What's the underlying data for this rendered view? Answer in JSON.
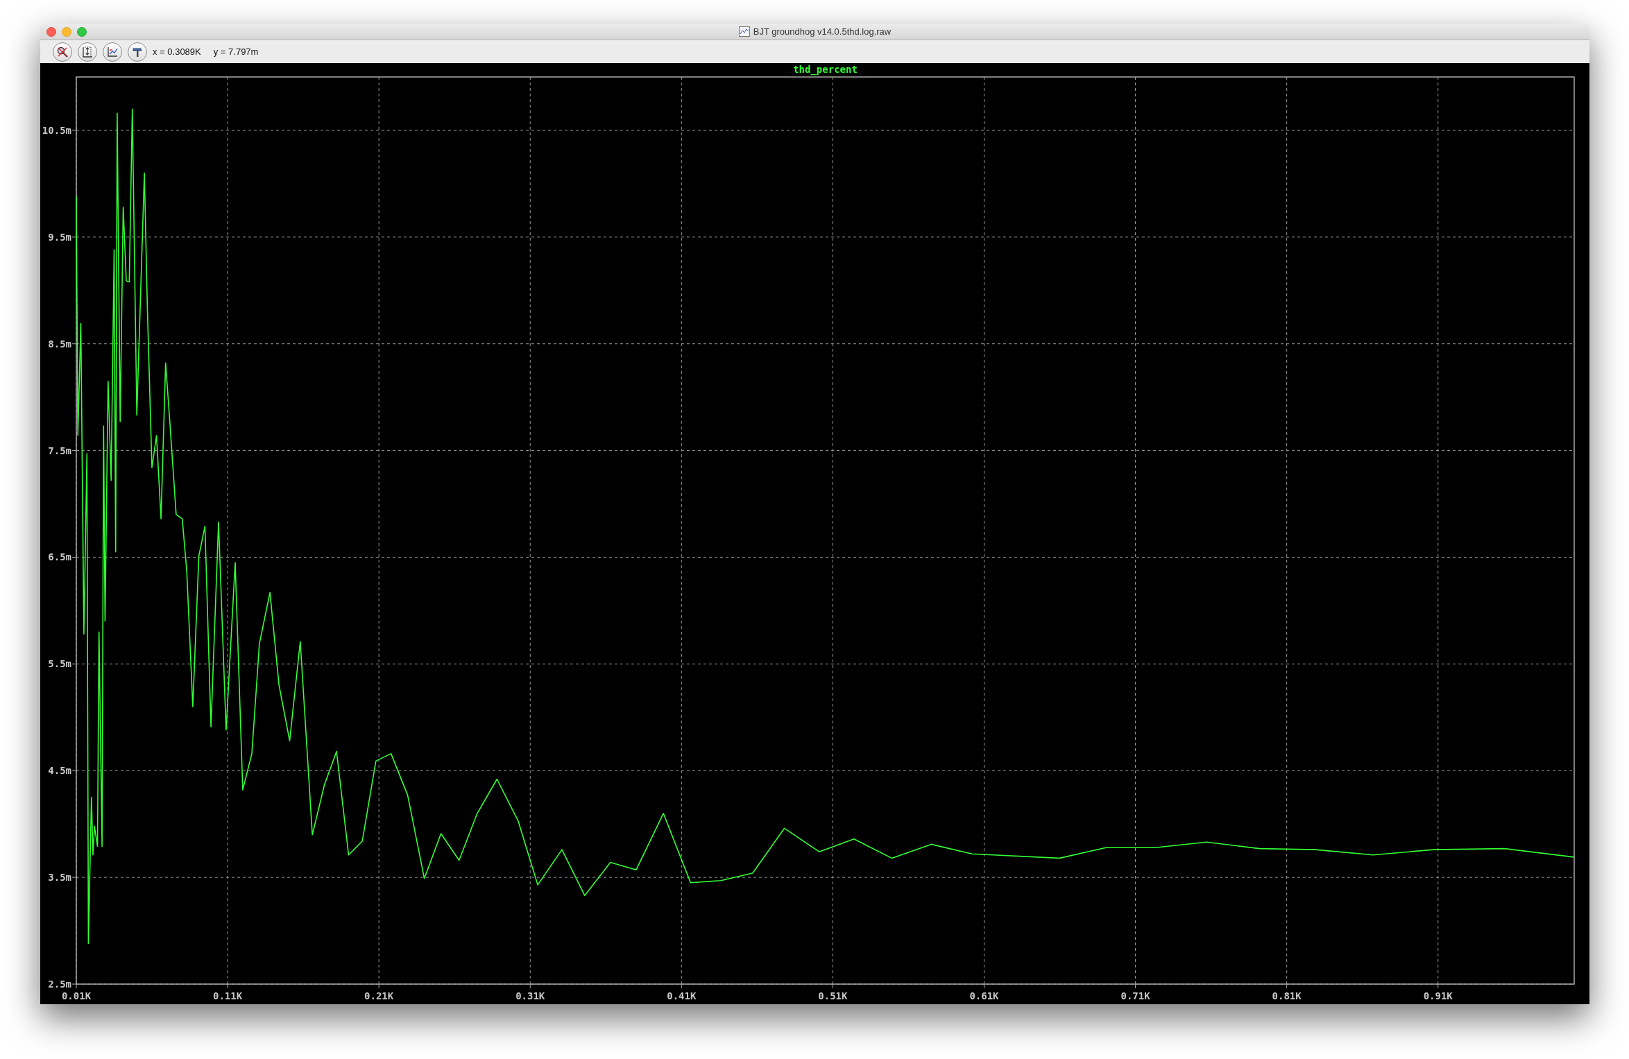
{
  "window": {
    "title": "BJT groundhog v14.0.5thd.log.raw"
  },
  "toolbar": {
    "cursor_x": "x = 0.3089K",
    "cursor_y": "y = 7.797m"
  },
  "plot": {
    "chart_data": {
      "type": "line",
      "title": "thd_percent",
      "x": [
        0.01,
        0.011,
        0.013,
        0.015,
        0.017,
        0.018,
        0.02,
        0.021,
        0.022,
        0.024,
        0.025,
        0.027,
        0.028,
        0.029,
        0.031,
        0.033,
        0.035,
        0.036,
        0.037,
        0.039,
        0.041,
        0.043,
        0.045,
        0.047,
        0.05,
        0.055,
        0.057,
        0.06,
        0.063,
        0.066,
        0.069,
        0.072,
        0.076,
        0.08,
        0.083,
        0.087,
        0.091,
        0.095,
        0.099,
        0.104,
        0.109,
        0.115,
        0.12,
        0.126,
        0.131,
        0.138,
        0.144,
        0.151,
        0.158,
        0.166,
        0.174,
        0.182,
        0.19,
        0.199,
        0.208,
        0.218,
        0.229,
        0.24,
        0.251,
        0.263,
        0.275,
        0.288,
        0.302,
        0.315,
        0.331,
        0.346,
        0.363,
        0.38,
        0.398,
        0.416,
        0.436,
        0.457,
        0.478,
        0.501,
        0.524,
        0.549,
        0.575,
        0.602,
        0.66,
        0.691,
        0.724,
        0.757,
        0.792,
        0.829,
        0.867,
        0.907,
        0.954,
        1.0
      ],
      "series": [
        {
          "color": "#33ff33",
          "values": [
            9.88,
            7.64,
            8.69,
            5.78,
            7.47,
            2.88,
            4.25,
            3.71,
            3.98,
            3.79,
            5.8,
            3.79,
            7.73,
            5.9,
            8.15,
            7.22,
            9.38,
            6.55,
            10.66,
            7.77,
            9.78,
            9.09,
            9.08,
            10.7,
            7.83,
            10.1,
            8.81,
            7.34,
            7.64,
            6.86,
            8.32,
            7.73,
            6.9,
            6.86,
            6.37,
            5.1,
            6.51,
            6.79,
            4.91,
            6.83,
            4.88,
            6.45,
            4.32,
            4.66,
            5.69,
            6.17,
            5.3,
            4.78,
            5.71,
            3.9,
            4.37,
            4.68,
            3.71,
            3.84,
            4.59,
            4.66,
            4.27,
            3.49,
            3.91,
            3.66,
            4.1,
            4.42,
            4.03,
            3.43,
            3.76,
            3.33,
            3.64,
            3.57,
            4.1,
            3.45,
            3.47,
            3.54,
            3.96,
            3.74,
            3.86,
            3.68,
            3.81,
            3.72,
            3.68,
            3.78,
            3.78,
            3.83,
            3.77,
            3.76,
            3.71,
            3.76,
            3.77,
            3.69
          ]
        }
      ],
      "grid": true,
      "xlim": [
        0.01,
        1.0
      ],
      "ylim": [
        2.5,
        11.0
      ],
      "xticks": [
        {
          "value": 0.01,
          "label": "0.01K"
        },
        {
          "value": 0.11,
          "label": "0.11K"
        },
        {
          "value": 0.21,
          "label": "0.21K"
        },
        {
          "value": 0.31,
          "label": "0.31K"
        },
        {
          "value": 0.41,
          "label": "0.41K"
        },
        {
          "value": 0.51,
          "label": "0.51K"
        },
        {
          "value": 0.61,
          "label": "0.61K"
        },
        {
          "value": 0.71,
          "label": "0.71K"
        },
        {
          "value": 0.81,
          "label": "0.81K"
        },
        {
          "value": 0.91,
          "label": "0.91K"
        }
      ],
      "yticks": [
        {
          "value": 2.5,
          "label": "2.5m"
        },
        {
          "value": 3.5,
          "label": "3.5m"
        },
        {
          "value": 4.5,
          "label": "4.5m"
        },
        {
          "value": 5.5,
          "label": "5.5m"
        },
        {
          "value": 6.5,
          "label": "6.5m"
        },
        {
          "value": 7.5,
          "label": "7.5m"
        },
        {
          "value": 8.5,
          "label": "8.5m"
        },
        {
          "value": 9.5,
          "label": "9.5m"
        },
        {
          "value": 10.5,
          "label": "10.5m"
        }
      ]
    }
  }
}
